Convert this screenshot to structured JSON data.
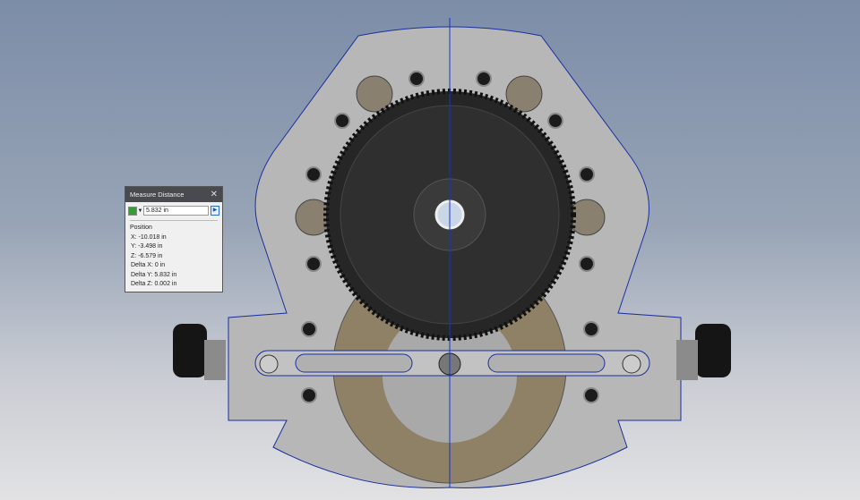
{
  "dialog": {
    "title": "Measure Distance",
    "close_icon": "close-icon",
    "selector_icon": "select-filter-icon",
    "distance_value": "5.832 in",
    "go_icon": "arrow-right-icon",
    "position_label": "Position",
    "x": "X: -10.018 in",
    "y": "Y: -3.498 in",
    "z": "Z: -6.579 in",
    "delta_x": "Delta X: 0 in",
    "delta_y": "Delta Y: 5.832 in",
    "delta_z": "Delta Z: 0.002 in"
  },
  "colors": {
    "measure_line": "#1a2fd6",
    "plate": "#b9b9b9",
    "gear": "#2e2e2e",
    "tan_gear": "#8a7c5c"
  }
}
